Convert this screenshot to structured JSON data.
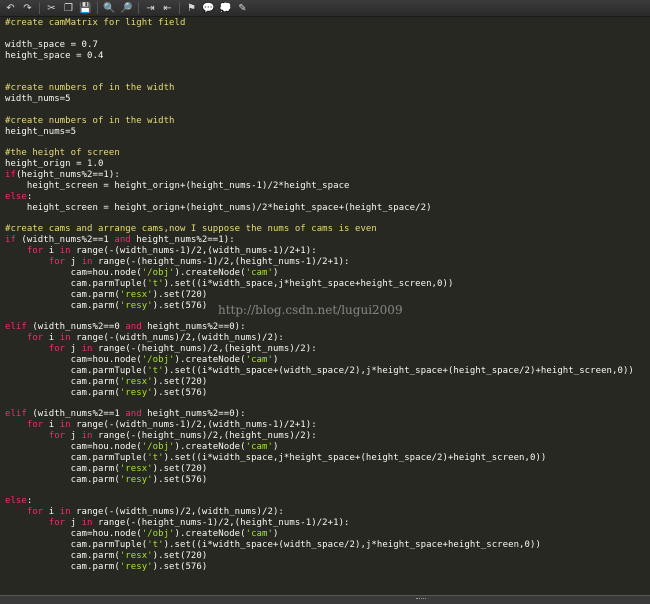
{
  "toolbar": {
    "buttons": [
      "undo-icon",
      "redo-icon",
      "cut-icon",
      "copy-icon",
      "save-icon",
      "find-icon",
      "find-replace-icon",
      "indent-icon",
      "outdent-icon",
      "bookmark-icon",
      "comment-icon",
      "uncomment-icon",
      "notes-icon"
    ],
    "glyphs": [
      "↶",
      "↷",
      "✂",
      "❐",
      "💾",
      "🔍",
      "🔎",
      "⇥",
      "⇤",
      "⚑",
      "💬",
      "💭",
      "✎"
    ]
  },
  "code": {
    "l1": "#create camMatrix for light field",
    "l3": "width_space = 0.7",
    "l4": "height_space = 0.4",
    "l7": "#create numbers of in the width",
    "l8": "width_nums=5",
    "l10": "#create numbers of in the width",
    "l11": "height_nums=5",
    "l13": "#the height of screen",
    "l14": "height_orign = 1.0",
    "l15_kw": "if",
    "l15": "(height_nums%2==1):",
    "l16": "    height_screen = height_orign+(height_nums-1)/2*height_space",
    "l17_kw": "else",
    "l17": ":",
    "l18": "    height_screen = height_orign+(height_nums)/2*height_space+(height_space/2)",
    "l20": "#create cams and arrange cams,now I suppose the nums of cams is even",
    "l21_kw": "if",
    "l21a": " (width_nums%2==1 ",
    "l21_and": "and",
    "l21b": " height_nums%2==1):",
    "for": "for",
    "in": "in",
    "elif": "elif",
    "else": "else",
    "and": "and",
    "l22a": "    ",
    "l22b": " i ",
    "l22c": " range(-(width_nums-1)/2,(width_nums-1)/2+1):",
    "l23a": "        ",
    "l23b": " j ",
    "l23c": " range(-(height_nums-1)/2,(height_nums-1)/2+1):",
    "cam_create_a": "            cam=hou.node(",
    "obj": "'/obj'",
    "cam_create_b": ").createNode(",
    "cam_str": "'cam'",
    "cam_create_c": ")",
    "parm_tuple_a": "            cam.parmTuple(",
    "t_str": "'t'",
    "l25b": ").set((i*width_space,j*height_space+height_screen,0))",
    "parm_a": "            cam.parm(",
    "resx": "'resx'",
    "resx_b": ").set(720)",
    "resy": "'resy'",
    "resy_b": ").set(576)",
    "l30a": " (width_nums%2==0 ",
    "l30b": " height_nums%2==0):",
    "l31c": " range(-(width_nums)/2,(width_nums)/2):",
    "l32c": " range(-(height_nums)/2,(height_nums)/2):",
    "l34b": ").set((i*width_space+(width_space/2),j*height_space+(height_space/2)+height_screen,0))",
    "l38a": " (width_nums%2==1 ",
    "l38b": " height_nums%2==0):",
    "l39c": " range(-(width_nums-1)/2,(width_nums-1)/2+1):",
    "l40c": " range(-(height_nums)/2,(height_nums)/2):",
    "l42b": ").set((i*width_space,j*height_space+(height_space/2)+height_screen,0))",
    "colon": ":",
    "l47c": " range(-(width_nums)/2,(width_nums)/2):",
    "l48c": " range(-(height_nums-1)/2,(height_nums-1)/2+1):",
    "l50b": ").set((i*width_space+(width_space/2),j*height_space+height_screen,0))"
  },
  "watermark": "http://blog.csdn.net/lugui2009",
  "colors": {
    "background": "#272822",
    "comment": "#e6db74",
    "keyword": "#f92672",
    "string": "#a6e22e",
    "text": "#f8f8f2"
  }
}
